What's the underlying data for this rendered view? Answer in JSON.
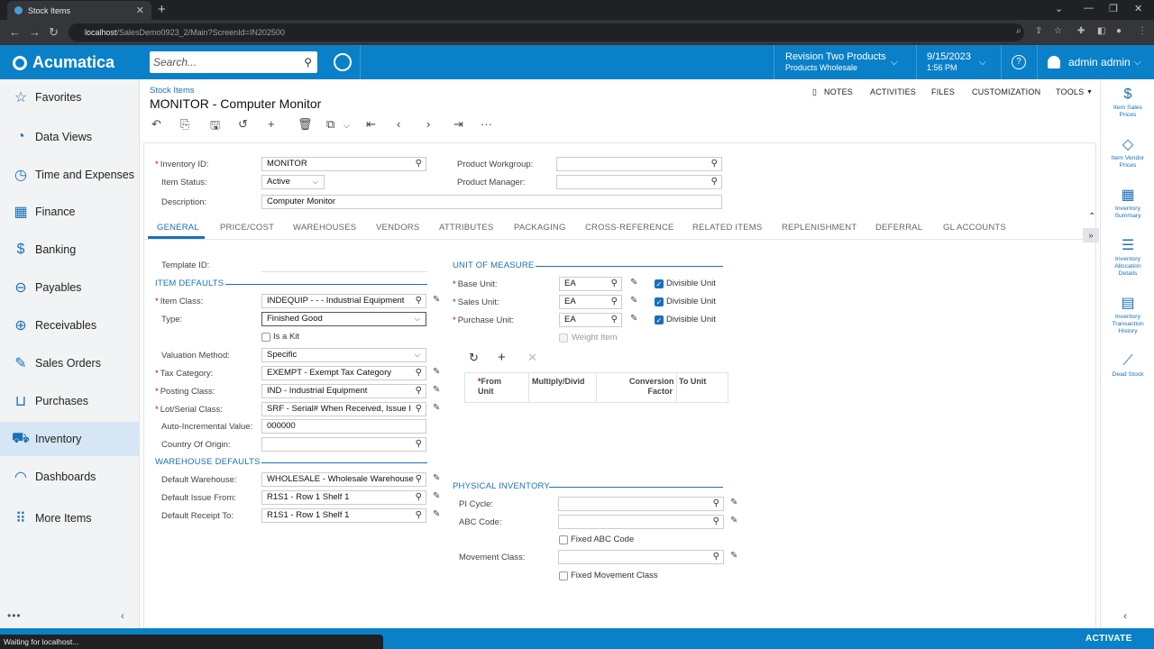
{
  "browser": {
    "tab_title": "Stock Items",
    "new_tab": "+",
    "url_host": "localhost",
    "url_path": "/SalesDemo0923_2/Main?ScreenId=IN202500"
  },
  "header": {
    "logo_text": "Acumatica",
    "search_placeholder": "Search...",
    "company_line1": "Revision Two Products",
    "company_line2": "Products Wholesale",
    "date": "9/15/2023",
    "time": "1:56 PM",
    "help": "?",
    "user": "admin admin"
  },
  "sidebar": {
    "items": [
      {
        "label": "Favorites",
        "icon": "star-icon",
        "glyph": "☆"
      },
      {
        "label": "Data Views",
        "icon": "pie-chart-icon",
        "glyph": "◔"
      },
      {
        "label": "Time and Expenses",
        "icon": "clock-icon",
        "glyph": "◷"
      },
      {
        "label": "Finance",
        "icon": "calculator-icon",
        "glyph": "▦"
      },
      {
        "label": "Banking",
        "icon": "dollar-icon",
        "glyph": "$"
      },
      {
        "label": "Payables",
        "icon": "minus-circle-icon",
        "glyph": "⊖"
      },
      {
        "label": "Receivables",
        "icon": "plus-circle-icon",
        "glyph": "⊕"
      },
      {
        "label": "Sales Orders",
        "icon": "edit-icon",
        "glyph": "✎"
      },
      {
        "label": "Purchases",
        "icon": "cart-icon",
        "glyph": "⊔"
      },
      {
        "label": "Inventory",
        "icon": "truck-icon",
        "glyph": "⛟"
      },
      {
        "label": "Dashboards",
        "icon": "gauge-icon",
        "glyph": "◠"
      },
      {
        "label": "More Items",
        "icon": "grid-dots-icon",
        "glyph": "⠿"
      }
    ],
    "active": "Inventory"
  },
  "page": {
    "breadcrumb": "Stock Items",
    "title": "MONITOR - Computer Monitor",
    "links": {
      "notes": "NOTES",
      "activities": "ACTIVITIES",
      "files": "FILES",
      "customization": "CUSTOMIZATION",
      "tools": "TOOLS"
    }
  },
  "form": {
    "inventory_id_label": "Inventory ID:",
    "inventory_id": "MONITOR",
    "item_status_label": "Item Status:",
    "item_status": "Active",
    "description_label": "Description:",
    "description": "Computer Monitor",
    "product_workgroup_label": "Product Workgroup:",
    "product_workgroup": "",
    "product_manager_label": "Product Manager:",
    "product_manager": ""
  },
  "tabs": [
    "GENERAL",
    "PRICE/COST",
    "WAREHOUSES",
    "VENDORS",
    "ATTRIBUTES",
    "PACKAGING",
    "CROSS-REFERENCE",
    "RELATED ITEMS",
    "REPLENISHMENT",
    "DEFERRAL",
    "GL ACCOUNTS"
  ],
  "tab_expand": "»",
  "general": {
    "template_id_label": "Template ID:",
    "item_defaults_title": "ITEM DEFAULTS",
    "item_class_label": "Item Class:",
    "item_class": "INDEQUIP  -  - - Industrial Equipment",
    "type_label": "Type:",
    "type": "Finished Good",
    "is_kit_label": "Is a Kit",
    "valuation_method_label": "Valuation Method:",
    "valuation_method": "Specific",
    "tax_category_label": "Tax Category:",
    "tax_category": "EXEMPT - Exempt Tax Category",
    "posting_class_label": "Posting Class:",
    "posting_class": "IND - Industrial Equipment",
    "lot_serial_class_label": "Lot/Serial Class:",
    "lot_serial_class": "SRF - Serial# When Received, Issue I",
    "auto_incremental_label": "Auto-Incremental Value:",
    "auto_incremental": "000000",
    "country_origin_label": "Country Of Origin:",
    "country_origin": "",
    "warehouse_defaults_title": "WAREHOUSE DEFAULTS",
    "default_warehouse_label": "Default Warehouse:",
    "default_warehouse": "WHOLESALE - Wholesale Warehouse",
    "default_issue_label": "Default Issue From:",
    "default_issue": "R1S1 - Row 1 Shelf 1",
    "default_receipt_label": "Default Receipt To:",
    "default_receipt": "R1S1 - Row 1 Shelf 1"
  },
  "uom": {
    "title": "UNIT OF MEASURE",
    "base_unit_label": "Base Unit:",
    "base_unit": "EA",
    "sales_unit_label": "Sales Unit:",
    "sales_unit": "EA",
    "purchase_unit_label": "Purchase Unit:",
    "purchase_unit": "EA",
    "divisible_label": "Divisible Unit",
    "weight_item_label": "Weight Item",
    "grid_headers": {
      "from_unit_1": "From",
      "from_unit_2": "Unit",
      "multiply": "Multiply/Divid",
      "conversion_1": "Conversion",
      "conversion_2": "Factor",
      "to_unit": "To Unit"
    }
  },
  "physical": {
    "title": "PHYSICAL INVENTORY",
    "pi_cycle_label": "PI Cycle:",
    "pi_cycle": "",
    "abc_code_label": "ABC Code:",
    "abc_code": "",
    "fixed_abc_label": "Fixed ABC Code",
    "movement_class_label": "Movement Class:",
    "movement_class": "",
    "fixed_movement_label": "Fixed Movement Class"
  },
  "right_panel": [
    {
      "line1": "Item Sales",
      "line2": "Prices",
      "icon": "dollar-icon",
      "glyph": "$"
    },
    {
      "line1": "Item Vendor",
      "line2": "Prices",
      "icon": "tag-icon",
      "glyph": "◇"
    },
    {
      "line1": "Inventory",
      "line2": "Summary",
      "icon": "building-icon",
      "glyph": "▦"
    },
    {
      "line1": "Inventory",
      "line2": "Allocation",
      "line3": "Details",
      "icon": "list-icon",
      "glyph": "☰"
    },
    {
      "line1": "Inventory",
      "line2": "Transaction",
      "line3": "History",
      "icon": "document-icon",
      "glyph": "▤"
    },
    {
      "line1": "Dead Stock",
      "line2": "",
      "icon": "chart-icon",
      "glyph": "⟋"
    }
  ],
  "status": {
    "waiting": "Waiting for localhost...",
    "activate": "ACTIVATE"
  }
}
